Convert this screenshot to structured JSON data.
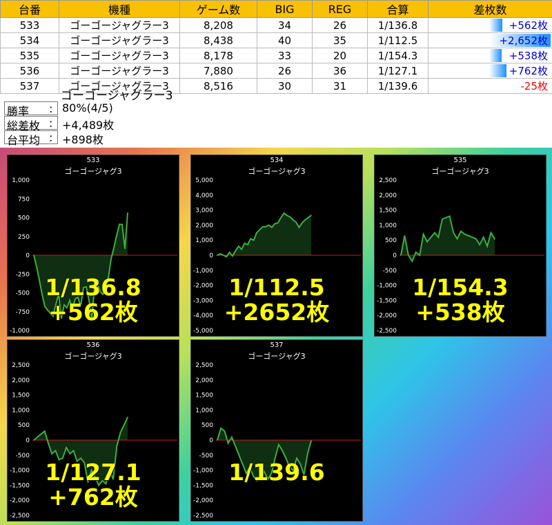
{
  "table": {
    "headers": [
      "台番",
      "機種",
      "ゲーム数",
      "BIG",
      "REG",
      "合算",
      "差枚数"
    ],
    "rows": [
      {
        "unit": "533",
        "machine": "ゴーゴージャグラー3",
        "games": "8,208",
        "big": "34",
        "reg": "26",
        "combined": "1/136.8",
        "diff": "+562枚",
        "diff_value": 562
      },
      {
        "unit": "534",
        "machine": "ゴーゴージャグラー3",
        "games": "8,438",
        "big": "40",
        "reg": "35",
        "combined": "1/112.5",
        "diff": "+2,652枚",
        "diff_value": 2652
      },
      {
        "unit": "535",
        "machine": "ゴーゴージャグラー3",
        "games": "8,178",
        "big": "33",
        "reg": "20",
        "combined": "1/154.3",
        "diff": "+538枚",
        "diff_value": 538
      },
      {
        "unit": "536",
        "machine": "ゴーゴージャグラー3",
        "games": "7,880",
        "big": "26",
        "reg": "36",
        "combined": "1/127.1",
        "diff": "+762枚",
        "diff_value": 762
      },
      {
        "unit": "537",
        "machine": "ゴーゴージャグラー3",
        "games": "8,516",
        "big": "30",
        "reg": "31",
        "combined": "1/139.6",
        "diff": "-25枚",
        "diff_value": -25
      }
    ],
    "colors": {
      "header_bg": "#f9c104",
      "positive": "#0000cc",
      "negative": "#ff0000",
      "bar": "#1e90ff"
    }
  },
  "summary": {
    "title": "ゴーゴージャグラー3",
    "win_rate_label": "勝率",
    "win_rate_value": "80%(4/5)",
    "total_label": "総差枚",
    "total_value": "+4,489枚",
    "average_label": "台平均",
    "average_value": "+898枚",
    "separator": ":"
  },
  "chart_data": [
    {
      "type": "line",
      "unit": "533",
      "title": "ゴーゴージャグ3",
      "ylim": [
        -1000,
        1000
      ],
      "yticks": [
        1000,
        750,
        500,
        250,
        0,
        -250,
        -500,
        -750,
        -1000
      ],
      "ytick_labels": [
        "1,000",
        "750",
        "500",
        "250",
        "0",
        "-250",
        "-500",
        "-750",
        "-1,000"
      ],
      "overlay_rate": "1/136.8",
      "overlay_diff": "+562枚",
      "values": [
        0,
        -150,
        -330,
        -520,
        -680,
        -730,
        -770,
        -810,
        -650,
        -520,
        -840,
        -660,
        -700,
        -600,
        -720,
        -580,
        -560,
        -680,
        -430,
        -420,
        -600,
        -850,
        -430,
        -380,
        -480,
        -520,
        -460,
        -300,
        -50,
        100,
        260,
        410,
        410,
        90,
        562
      ],
      "color": "#3cb043"
    },
    {
      "type": "line",
      "unit": "534",
      "title": "ゴーゴージャグ3",
      "ylim": [
        -5000,
        5000
      ],
      "yticks": [
        5000,
        4000,
        3000,
        2000,
        1000,
        0,
        -1000,
        -2000,
        -3000,
        -4000,
        -5000
      ],
      "ytick_labels": [
        "5,000",
        "4,000",
        "3,000",
        "2,000",
        "1,000",
        "0",
        "-1,000",
        "-2,000",
        "-3,000",
        "-4,000",
        "-5,000"
      ],
      "overlay_rate": "1/112.5",
      "overlay_diff": "+2652枚",
      "values": [
        0,
        100,
        0,
        -100,
        200,
        -50,
        300,
        600,
        400,
        800,
        700,
        1100,
        1000,
        1500,
        1700,
        1900,
        1900,
        2000,
        1850,
        2100,
        2150,
        2500,
        2800,
        2650,
        2550,
        2350,
        2200,
        1850,
        2150,
        2350,
        2500,
        2652
      ],
      "color": "#3cb043"
    },
    {
      "type": "line",
      "unit": "535",
      "title": "ゴーゴージャグ3",
      "ylim": [
        -2500,
        2500
      ],
      "yticks": [
        2500,
        2000,
        1500,
        1000,
        500,
        0,
        -500,
        -1000,
        -1500,
        -2000,
        -2500
      ],
      "ytick_labels": [
        "2,500",
        "2,000",
        "1,500",
        "1,000",
        "500",
        "0",
        "-500",
        "-1,000",
        "-1,500",
        "-2,000",
        "-2,500"
      ],
      "overlay_rate": "1/154.3",
      "overlay_diff": "+538枚",
      "values": [
        0,
        650,
        0,
        -200,
        100,
        0,
        700,
        450,
        600,
        750,
        600,
        1200,
        1250,
        1300,
        750,
        550,
        800,
        700,
        650,
        600,
        550,
        350,
        600,
        300,
        750,
        538
      ],
      "color": "#3cb043"
    },
    {
      "type": "line",
      "unit": "536",
      "title": "ゴーゴージャグ3",
      "ylim": [
        -2500,
        2500
      ],
      "yticks": [
        2500,
        2000,
        1500,
        1000,
        500,
        0,
        -500,
        -1000,
        -1500,
        -2000,
        -2500
      ],
      "ytick_labels": [
        "2,500",
        "2,000",
        "1,500",
        "1,000",
        "500",
        "0",
        "-500",
        "-1,000",
        "-1,500",
        "-2,000",
        "-2,500"
      ],
      "overlay_rate": "1/127.1",
      "overlay_diff": "+762枚",
      "values": [
        0,
        100,
        200,
        300,
        -100,
        -450,
        -350,
        -650,
        -600,
        -250,
        -450,
        -350,
        -700,
        -600,
        -750,
        -1400,
        -1000,
        -1250,
        -1500,
        -1350,
        -1450,
        -1000,
        -1300,
        -200,
        250,
        500,
        762
      ],
      "color": "#3cb043"
    },
    {
      "type": "line",
      "unit": "537",
      "title": "ゴーゴージャグ3",
      "ylim": [
        -2500,
        2500
      ],
      "yticks": [
        2500,
        2000,
        1500,
        1000,
        500,
        0,
        -500,
        -1000,
        -1500,
        -2000,
        -2500
      ],
      "ytick_labels": [
        "2,500",
        "2,000",
        "1,500",
        "1,000",
        "500",
        "0",
        "-500",
        "-1,000",
        "-1,500",
        "-2,000",
        "-2,500"
      ],
      "overlay_rate": "1/139.6",
      "overlay_diff": "",
      "values": [
        0,
        400,
        300,
        -100,
        100,
        -200,
        -500,
        -800,
        -1100,
        -900,
        -1200,
        -1350,
        -1250,
        -1050,
        -1300,
        -1100,
        -600,
        -150,
        -350,
        -600,
        -900,
        -1000,
        -600,
        -800,
        -1150,
        -450,
        -25
      ],
      "color": "#3cb043"
    }
  ]
}
